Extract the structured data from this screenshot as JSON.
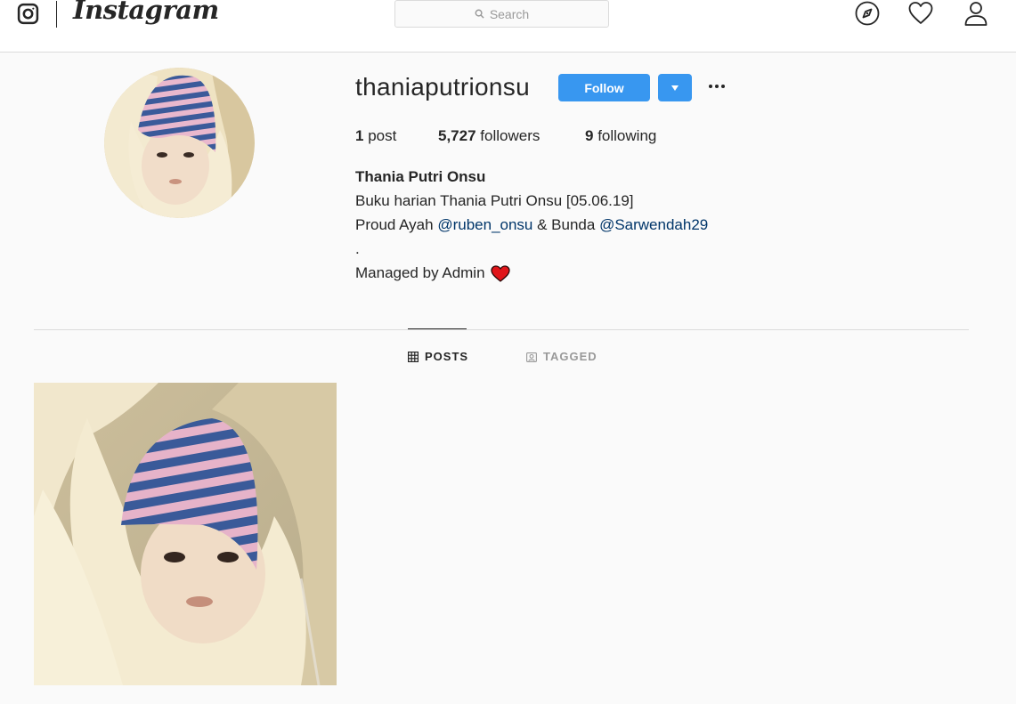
{
  "header": {
    "brand": "Instagram",
    "search_placeholder": "Search",
    "icons": [
      "instagram-glyph-icon",
      "search-icon",
      "compass-icon",
      "heart-icon",
      "user-icon"
    ]
  },
  "profile": {
    "username": "thaniaputrionsu",
    "follow_label": "Follow",
    "stats": {
      "posts_count": "1",
      "posts_label": "post",
      "followers_count": "5,727",
      "followers_label": "followers",
      "following_count": "9",
      "following_label": "following"
    },
    "full_name": "Thania Putri Onsu",
    "bio": {
      "line1": "Buku harian Thania Putri Onsu [05.06.19]",
      "line2_prefix": "Proud Ayah ",
      "mention1": "@ruben_onsu",
      "line2_mid": " & Bunda ",
      "mention2": "@Sarwendah29",
      "line3": ".",
      "line4": "Managed by Admin"
    }
  },
  "tabs": {
    "posts": "POSTS",
    "tagged": "TAGGED"
  },
  "colors": {
    "accent": "#3897f0",
    "mention": "#003569",
    "heart": "#e0151a"
  }
}
